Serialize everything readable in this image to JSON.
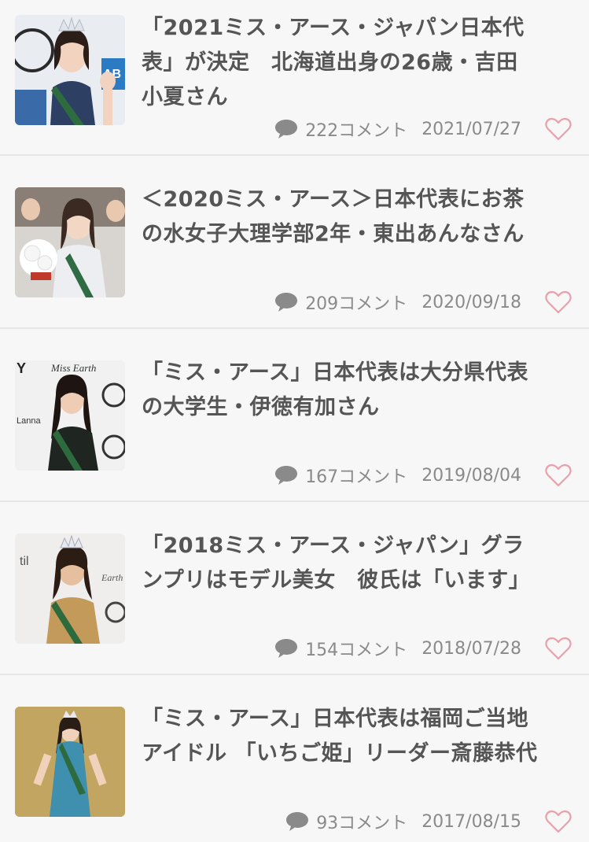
{
  "articles": [
    {
      "title": "「2021ミス・アース・ジャパン日本代表」が決定　北海道出身の26歳・吉田小夏さん",
      "title_display": "「2021ミス・アース・ジャパン日本代\n表」が決定　北海道出身の26歳・吉田\n小夏さん",
      "comments": "222コメント",
      "date": "2021/07/27",
      "thumb_icon": "pageant-winner-photo"
    },
    {
      "title": "＜2020ミス・アース＞日本代表にお茶の水女子大理学部2年・東出あんなさん",
      "title_display": "＜2020ミス・アース＞日本代表にお茶\nの水女子大理学部2年・東出あんなさん",
      "comments": "209コメント",
      "date": "2020/09/18",
      "thumb_icon": "pageant-winner-photo"
    },
    {
      "title": "「ミス・アース」日本代表は大分県代表の大学生・伊徳有加さん",
      "title_display": "「ミス・アース」日本代表は大分県代表\nの大学生・伊徳有加さん",
      "comments": "167コメント",
      "date": "2019/08/04",
      "thumb_icon": "pageant-winner-photo"
    },
    {
      "title": "「2018ミス・アース・ジャパン」グランプリはモデル美女　彼氏は「います」",
      "title_display": "「2018ミス・アース・ジャパン」グラ\nンプリはモデル美女　彼氏は「います」",
      "comments": "154コメント",
      "date": "2018/07/28",
      "thumb_icon": "pageant-winner-photo"
    },
    {
      "title": "「ミス・アース」日本代表は福岡ご当地アイドル 「いちご姫」リーダー斎藤恭代",
      "title_display": "「ミス・アース」日本代表は福岡ご当地\nアイドル 「いちご姫」リーダー斎藤恭代",
      "comments": "93コメント",
      "date": "2017/08/15",
      "thumb_icon": "pageant-winner-photo"
    }
  ],
  "icons": {
    "comment": "comment-bubble-icon",
    "favorite": "heart-outline-icon"
  },
  "colors": {
    "title": "#555555",
    "meta": "#8a8a8a",
    "heart": "#e8a0ad",
    "background": "#f7f7f7",
    "divider": "#e6e6e6"
  }
}
